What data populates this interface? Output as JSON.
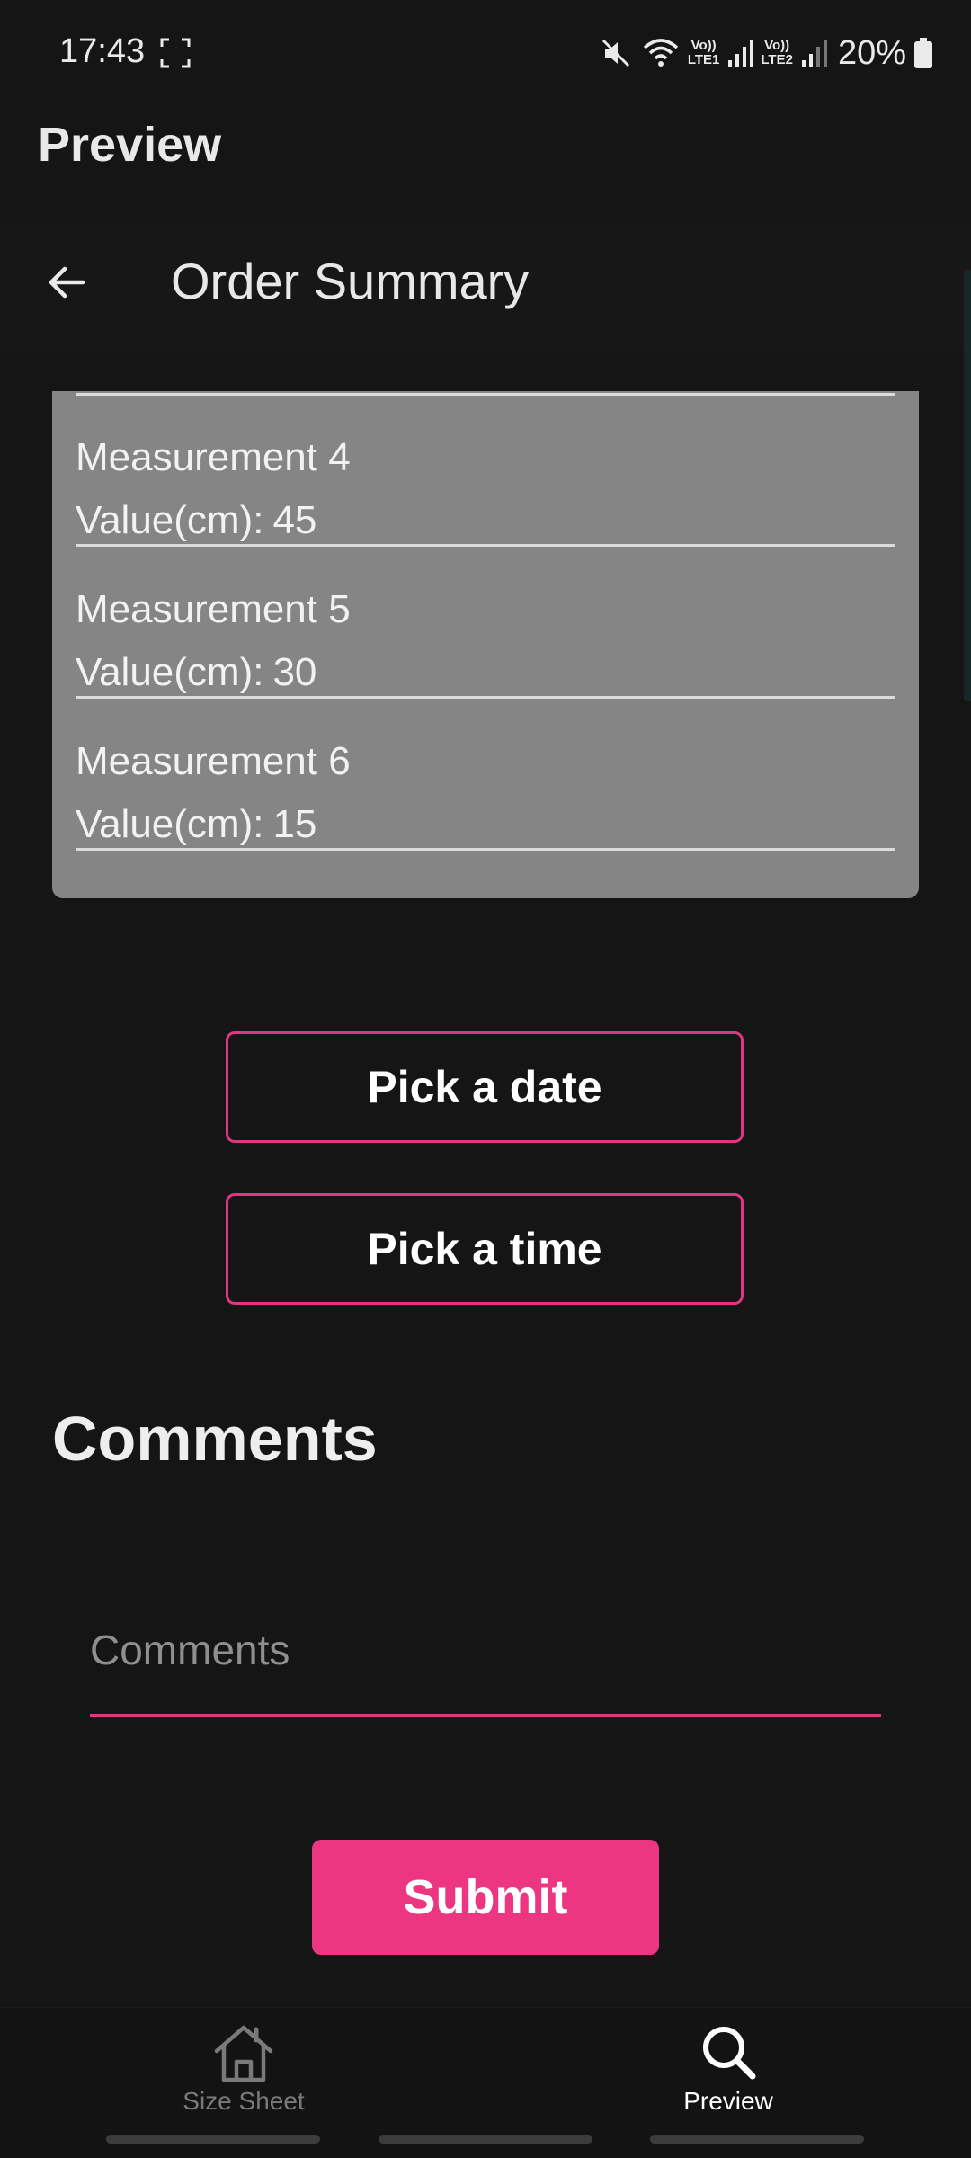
{
  "status_bar": {
    "time": "17:43",
    "battery": "20%",
    "lte1": "LTE1",
    "lte2": "LTE2",
    "volte": "Vo))",
    "icons": [
      "screen-record-icon",
      "mute-icon",
      "wifi-icon",
      "signal-icon",
      "battery-icon"
    ]
  },
  "app": {
    "title": "Preview"
  },
  "toolbar": {
    "title": "Order Summary",
    "back_icon": "arrow-left-icon"
  },
  "measurements": [
    {
      "name": "Measurement 4",
      "value_label": "Value(cm):",
      "value": "45"
    },
    {
      "name": "Measurement 5",
      "value_label": "Value(cm):",
      "value": "30"
    },
    {
      "name": "Measurement 6",
      "value_label": "Value(cm):",
      "value": "15"
    }
  ],
  "actions": {
    "pick_date": "Pick a date",
    "pick_time": "Pick a time",
    "submit": "Submit"
  },
  "comments": {
    "heading": "Comments",
    "placeholder": "Comments",
    "value": ""
  },
  "bottom_nav": {
    "items": [
      {
        "label": "Size Sheet",
        "icon": "home-icon",
        "selected": false
      },
      {
        "label": "Preview",
        "icon": "search-icon",
        "selected": true
      }
    ]
  },
  "colors": {
    "accent": "#ec3681",
    "background": "#151515",
    "card": "#858585"
  }
}
